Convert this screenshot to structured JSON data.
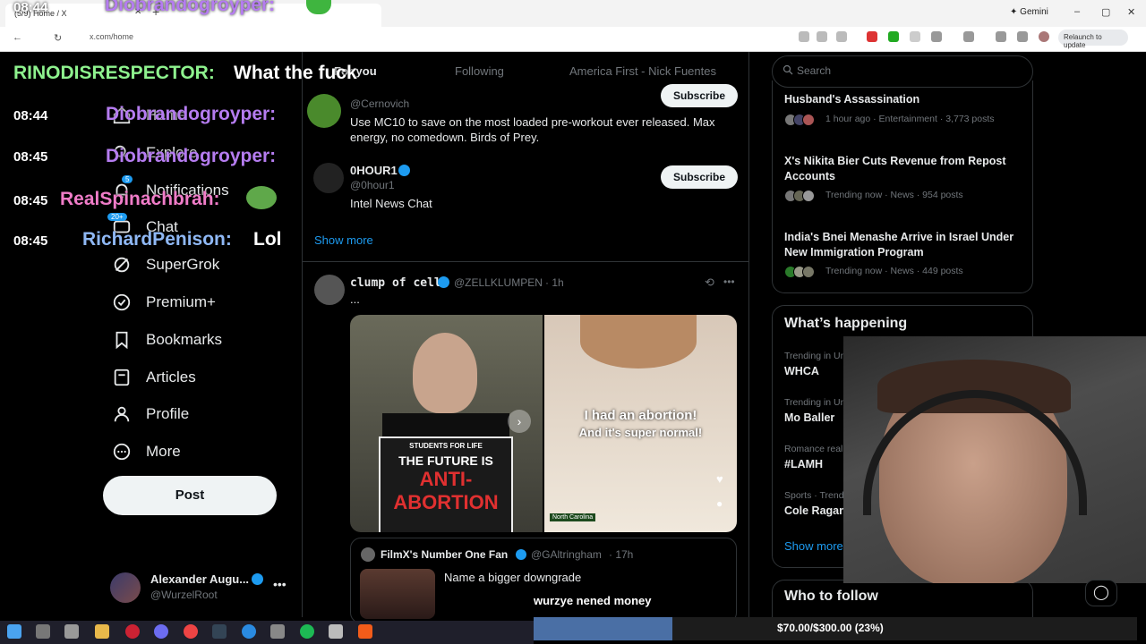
{
  "browser": {
    "tab_title": "(5/9) Home / X",
    "url": "x.com/home",
    "gemini_label": "Gemini",
    "relaunch_label": "Relaunch to update"
  },
  "nav": {
    "items": [
      {
        "label": "Home",
        "icon": "home-icon"
      },
      {
        "label": "Explore",
        "icon": "search-icon"
      },
      {
        "label": "Notifications",
        "icon": "bell-icon",
        "badge": "5"
      },
      {
        "label": "Chat",
        "icon": "chat-icon",
        "badge": "20+"
      },
      {
        "label": "SuperGrok",
        "icon": "grok-icon"
      },
      {
        "label": "Premium+",
        "icon": "verified-icon"
      },
      {
        "label": "Bookmarks",
        "icon": "bookmark-icon"
      },
      {
        "label": "Articles",
        "icon": "articles-icon"
      },
      {
        "label": "Profile",
        "icon": "person-icon"
      },
      {
        "label": "More",
        "icon": "more-icon"
      }
    ],
    "post_label": "Post",
    "account": {
      "name": "Alexander Augu...",
      "handle": "@WurzelRoot",
      "more": "•••"
    }
  },
  "top_tabs": [
    "For you",
    "Following",
    "America First - Nick Fuentes"
  ],
  "feed": {
    "sub1": {
      "handle": "@Cernovich",
      "bio": "Use MC10 to save on the most loaded pre-workout ever released. Max energy, no comedown. Birds of Prey.",
      "button": "Subscribe"
    },
    "sub2": {
      "name": "0HOUR1",
      "handle": "@0hour1",
      "bio": "Intel News Chat",
      "button": "Subscribe"
    },
    "show_more": "Show more",
    "post": {
      "name": "clump of cells",
      "handle": "@ZELLKLUMPEN",
      "time": "· 1h",
      "text": "...",
      "more": "•••",
      "image_left_caption1": "STUDENTS FOR LIFE",
      "image_left_caption2": "THE FUTURE IS",
      "image_left_caption3": "ANTI-",
      "image_left_caption4": "ABORTION",
      "image_right_line1": "I had an abortion!",
      "image_right_line2": "And it's super normal!",
      "image_right_tag": "North Carolina",
      "quote": {
        "name": "FilmX's Number One Fan",
        "handle": "@GAltringham",
        "time": "· 17h",
        "text": "Name a bigger downgrade"
      }
    }
  },
  "right": {
    "search_placeholder": "Search",
    "trends_top": [
      {
        "title": "Husband's Assassination",
        "meta": "1 hour ago · Entertainment · 3,773 posts"
      },
      {
        "title": "X's Nikita Bier Cuts Revenue from Repost Accounts",
        "meta": "Trending now · News · 954 posts"
      },
      {
        "title": "India's Bnei Menashe Arrive in Israel Under New Immigration Program",
        "meta": "Trending now · News · 449 posts"
      }
    ],
    "whats_happening": "What’s happening",
    "happening": [
      {
        "context": "Trending in United States",
        "title": "WHCA"
      },
      {
        "context": "Trending in United States",
        "title": "Mo Baller"
      },
      {
        "context": "Romance reality",
        "title": "#LAMH"
      },
      {
        "context": "Sports · Trending",
        "title": "Cole Ragan"
      }
    ],
    "show_more": "Show more",
    "who_to_follow": "Who to follow"
  },
  "overlay_chat": [
    {
      "time": "08:44",
      "user": "Diobrandogroyper:",
      "msg": "",
      "color": "#b57cf0"
    },
    {
      "time": "08:44",
      "user": "RINODISRESPECTOR:",
      "msg": "What the fuck",
      "color": "#8ef28e"
    },
    {
      "time": "08:44",
      "user": "Diobrandogroyper:",
      "msg": "",
      "color": "#b57cf0"
    },
    {
      "time": "08:45",
      "user": "Diobrandogroyper:",
      "msg": "",
      "color": "#b57cf0"
    },
    {
      "time": "08:45",
      "user": "RealSpinachbrah:",
      "msg": "",
      "color": "#f07cc8"
    },
    {
      "time": "08:45",
      "user": "RichardPenison:",
      "msg": "Lol",
      "color": "#8fb8f5"
    }
  ],
  "donation": {
    "label": "wurzye nened money",
    "progress_text": "$70.00/$300.00 (23%)",
    "fraction": 0.23,
    "fill_color": "#4a6fa5"
  }
}
